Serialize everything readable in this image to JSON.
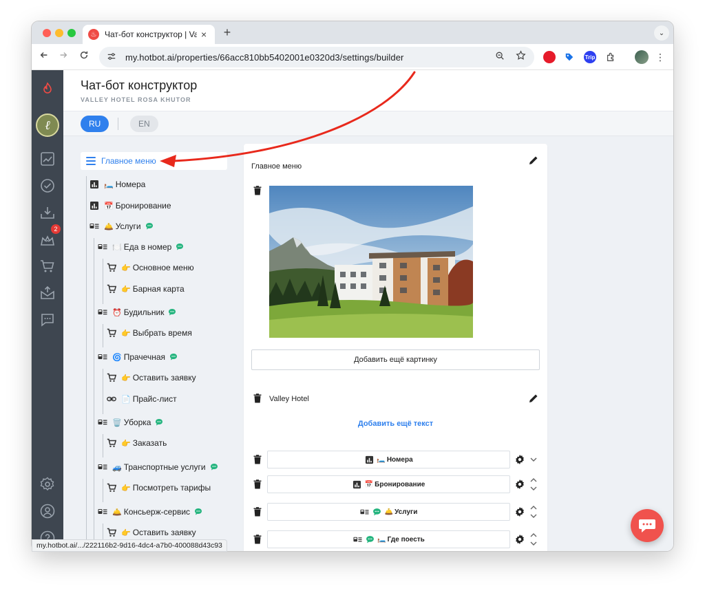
{
  "browser": {
    "tab_title": "Чат-бот конструктор | Valley",
    "url": "my.hotbot.ai/properties/66acc810bb5402001e0320d3/settings/builder",
    "status_url": "my.hotbot.ai/.../222116b2-9d16-4dc4-a7b0-400088d43c93",
    "favicon_glyph": "♨",
    "new_tab_glyph": "+",
    "close_glyph": "×",
    "tab_menu_glyph": "⌄",
    "ext_labels": [
      "",
      "",
      "Trip",
      ""
    ]
  },
  "header": {
    "title": "Чат-бот конструктор",
    "subtitle": "VALLEY HOTEL ROSA KHUTOR"
  },
  "languages": {
    "active": "RU",
    "inactive": "EN"
  },
  "sidebar": {
    "badge_count": "2",
    "brand_glyph": "ℓ"
  },
  "tree": {
    "root_label": "Главное меню",
    "nodes": [
      {
        "icon": "stats",
        "emoji": "🛏️",
        "label": "Номера"
      },
      {
        "icon": "stats",
        "emoji": "📅",
        "label": "Бронирование"
      },
      {
        "icon": "menu-list",
        "emoji": "🛎️",
        "label": "Услуги"
      },
      {
        "icon": "menu-list",
        "emoji": "🍽️",
        "label": "Еда в номер"
      },
      {
        "icon": "cart",
        "emoji": "👉",
        "label": "Основное меню"
      },
      {
        "icon": "cart",
        "emoji": "👉",
        "label": "Барная карта"
      },
      {
        "icon": "menu-list",
        "emoji": "⏰",
        "label": "Будильник"
      },
      {
        "icon": "cart",
        "emoji": "👉",
        "label": "Выбрать время"
      },
      {
        "icon": "menu-list",
        "emoji": "🌀",
        "label": "Прачечная"
      },
      {
        "icon": "cart",
        "emoji": "👉",
        "label": "Оставить заявку"
      },
      {
        "icon": "link",
        "emoji": "📄",
        "label": "Прайс-лист"
      },
      {
        "icon": "menu-list",
        "emoji": "🗑️",
        "label": "Уборка"
      },
      {
        "icon": "cart",
        "emoji": "👉",
        "label": "Заказать"
      },
      {
        "icon": "menu-list",
        "emoji": "🚙",
        "label": "Транспортные услуги"
      },
      {
        "icon": "cart",
        "emoji": "👉",
        "label": "Посмотреть тарифы"
      },
      {
        "icon": "menu-list",
        "emoji": "🛎️",
        "label": "Консьерж-сервис"
      },
      {
        "icon": "cart",
        "emoji": "👉",
        "label": "Оставить заявку"
      }
    ]
  },
  "editor": {
    "title": "Главное меню",
    "add_image_label": "Добавить ещё картинку",
    "text_block": "Valley Hotel",
    "add_text_label": "Добавить ещё текст",
    "buttons": [
      {
        "emoji": "🛏️",
        "label": "Номера"
      },
      {
        "emoji": "📅",
        "label": "Бронирование"
      },
      {
        "emoji": "🛎️",
        "label": "Услуги"
      },
      {
        "emoji": "🛏️",
        "label": "Где поесть"
      }
    ]
  },
  "colors": {
    "accent": "#2f80ed",
    "rail": "#3e4650",
    "annotation": "#e8291c",
    "fab": "#f0524d"
  }
}
